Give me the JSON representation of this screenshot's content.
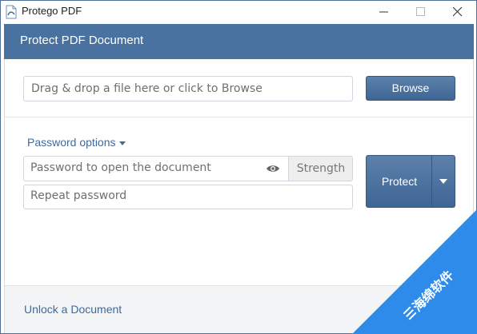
{
  "window": {
    "title": "Protego PDF",
    "icon": "app-pdf-icon"
  },
  "header": {
    "title": "Protect PDF Document",
    "color": "#4a72a0"
  },
  "dropzone": {
    "placeholder": "Drag & drop a file here or click to Browse"
  },
  "browse": {
    "label": "Browse"
  },
  "password": {
    "options_label": "Password options",
    "open_placeholder": "Password to open the document",
    "strength_label": "Strength",
    "repeat_placeholder": "Repeat password"
  },
  "protect": {
    "label": "Protect"
  },
  "footer": {
    "unlock_label": "Unlock a Document"
  },
  "watermark": {
    "text": "海绵软件",
    "color": "#2e8bea"
  }
}
